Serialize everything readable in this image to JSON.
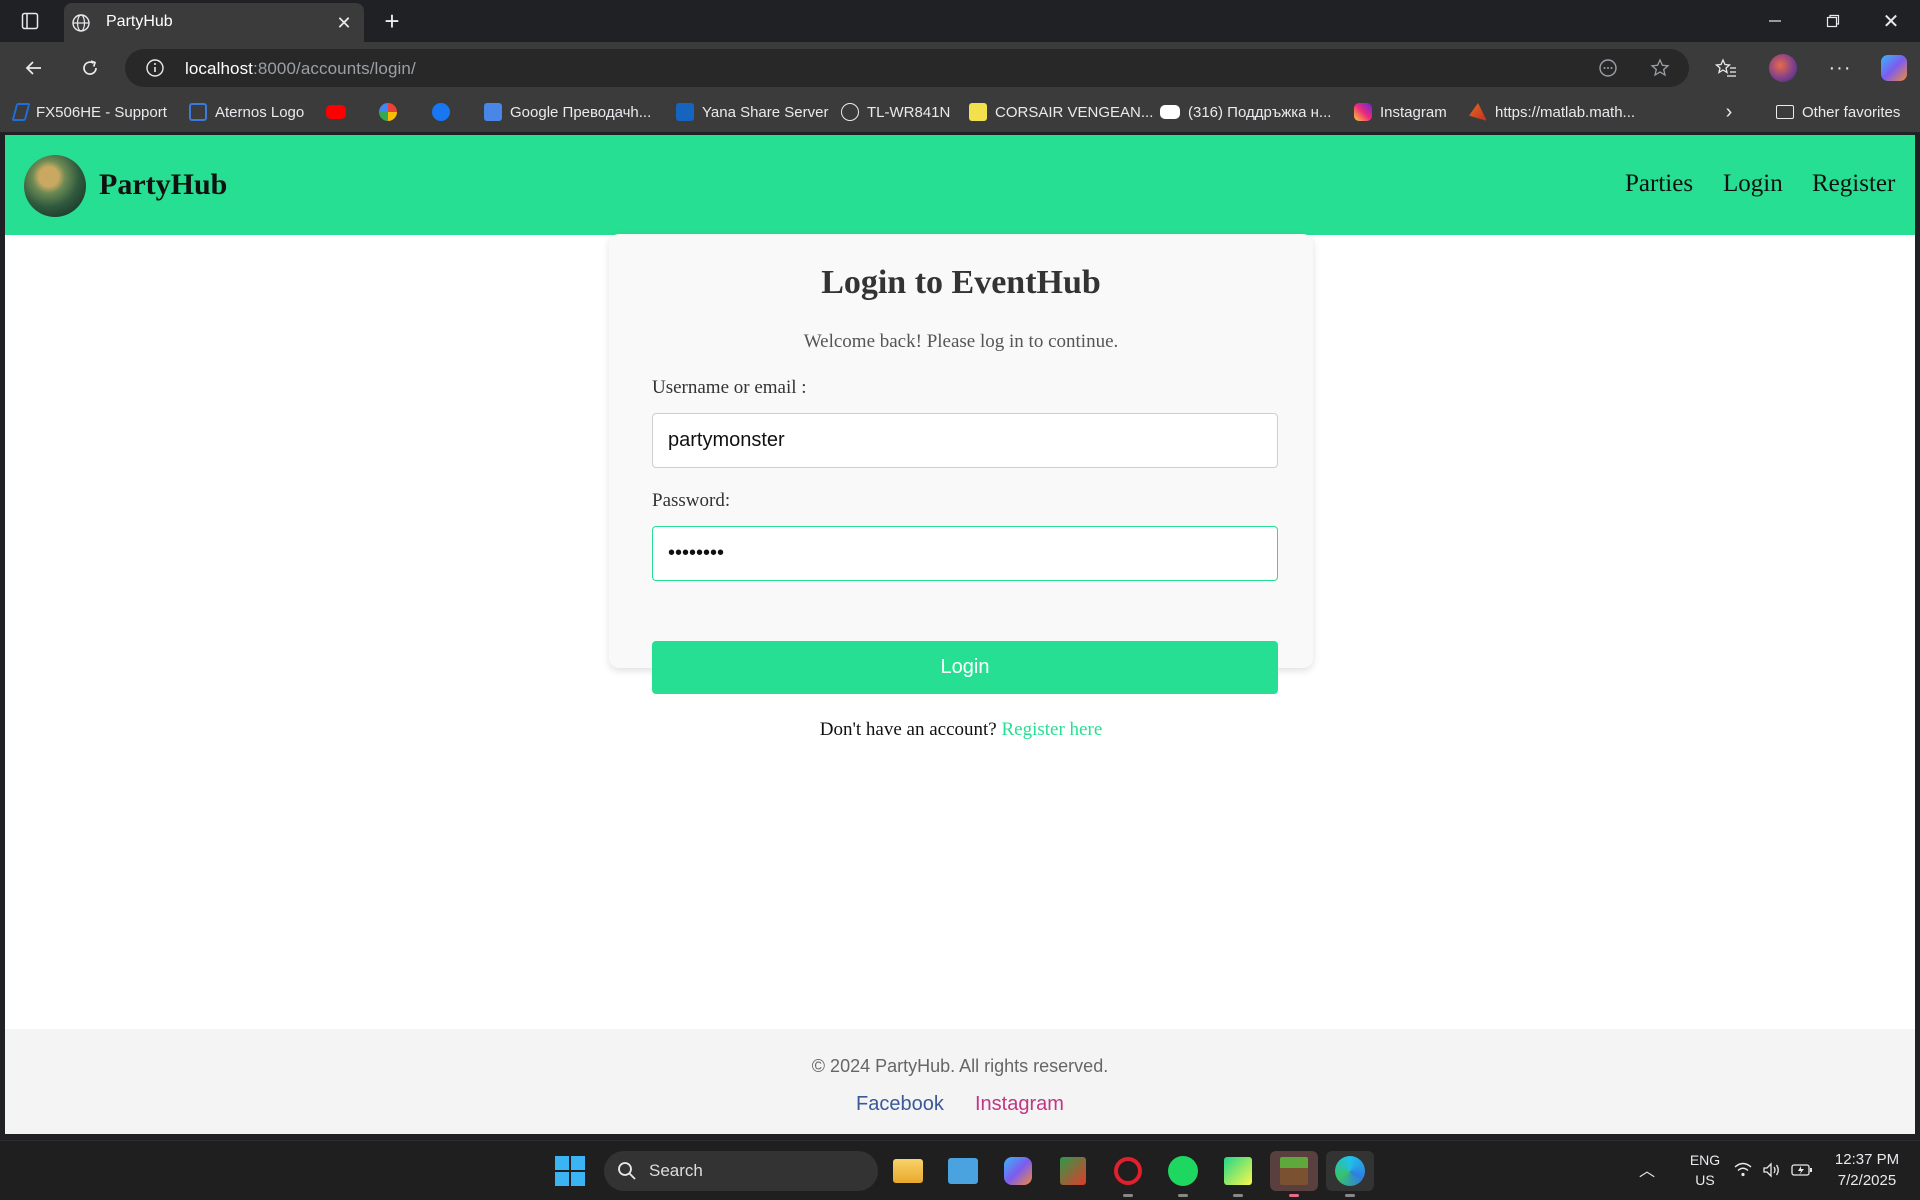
{
  "browser": {
    "tab_title": "PartyHub",
    "url_host": "localhost",
    "url_rest": ":8000/accounts/login/",
    "bookmarks": [
      {
        "label": "FX506HE - Support",
        "icon": "asus-icon",
        "color": "#1e6fd9"
      },
      {
        "label": "Aternos Logo",
        "icon": "aternos-icon",
        "color": "#3b7bd8"
      },
      {
        "label": "",
        "icon": "youtube-icon",
        "color": "#ff0000"
      },
      {
        "label": "",
        "icon": "google-icon",
        "color": "#ffffff"
      },
      {
        "label": "",
        "icon": "facebook-icon",
        "color": "#1877f2"
      },
      {
        "label": "Google Преводачh...",
        "icon": "translate-icon",
        "color": "#4a86e8"
      },
      {
        "label": "Yana Share Server",
        "icon": "dsm-icon",
        "color": "#1565c0"
      },
      {
        "label": "TL-WR841N",
        "icon": "globe-icon",
        "color": "#e8eaed"
      },
      {
        "label": "CORSAIR VENGEAN...",
        "icon": "corsair-icon",
        "color": "#f2e04c"
      },
      {
        "label": "(316) Поддръжка н...",
        "icon": "youtube-icon",
        "color": "#ffffff"
      },
      {
        "label": "Instagram",
        "icon": "instagram-icon",
        "color": "#e1306c"
      },
      {
        "label": "https://matlab.math...",
        "icon": "matlab-icon",
        "color": "#e86b1f"
      }
    ],
    "other_favorites": "Other favorites"
  },
  "site": {
    "brand": "PartyHub",
    "nav": {
      "parties": "Parties",
      "login": "Login",
      "register": "Register"
    },
    "brand_color": "#26df92"
  },
  "login": {
    "title": "Login to EventHub",
    "subtitle": "Welcome back! Please log in to continue.",
    "username_label": "Username or email :",
    "username_value": "partymonster",
    "password_label": "Password:",
    "password_value": "••••••••",
    "button_label": "Login",
    "register_prompt": "Don't have an account?",
    "register_link": "Register here"
  },
  "footer": {
    "copyright": "© 2024 PartyHub. All rights reserved.",
    "facebook": "Facebook",
    "instagram": "Instagram"
  },
  "taskbar": {
    "search_label": "Search",
    "lang_top": "ENG",
    "lang_bottom": "US",
    "time": "12:37 PM",
    "date": "7/2/2025"
  }
}
